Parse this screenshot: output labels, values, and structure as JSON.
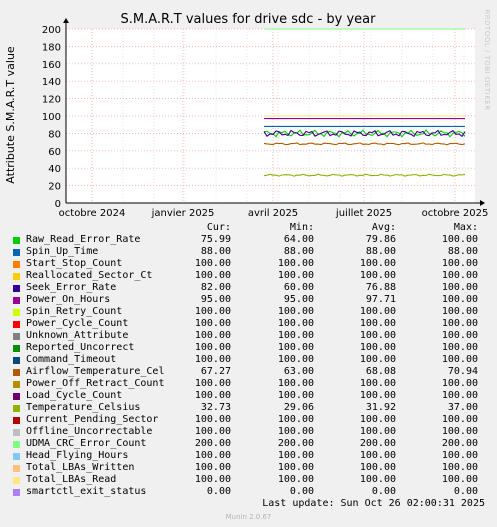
{
  "chart_data": {
    "type": "line",
    "title": "S.M.A.R.T values for drive sdc - by year",
    "ylabel": "Attribute S.M.A.R.T value",
    "side_text": "RRDTOOL / TOBI OETIKER",
    "ylim": [
      0,
      200
    ],
    "y_ticks": [
      "0",
      "20",
      "40",
      "60",
      "80",
      "100",
      "120",
      "140",
      "160",
      "180",
      "200"
    ],
    "x_ticks": [
      "octobre 2024",
      "janvier 2025",
      "avril 2025",
      "juillet 2025",
      "octobre 2025"
    ],
    "grid": true,
    "columns": [
      "Cur:",
      "Min:",
      "Avg:",
      "Max:"
    ],
    "series": [
      {
        "name": "Raw_Read_Error_Rate",
        "color": "#00cc00",
        "cur": "75.99",
        "min": "64.00",
        "avg": "79.86",
        "max": "100.00",
        "level": 80
      },
      {
        "name": "Spin_Up_Time",
        "color": "#0066b3",
        "cur": "88.00",
        "min": "88.00",
        "avg": "88.00",
        "max": "88.00",
        "level": 88
      },
      {
        "name": "Start_Stop_Count",
        "color": "#ff8000",
        "cur": "100.00",
        "min": "100.00",
        "avg": "100.00",
        "max": "100.00",
        "level": 100
      },
      {
        "name": "Reallocated_Sector_Ct",
        "color": "#ffcc00",
        "cur": "100.00",
        "min": "100.00",
        "avg": "100.00",
        "max": "100.00",
        "level": 100
      },
      {
        "name": "Seek_Error_Rate",
        "color": "#330099",
        "cur": "82.00",
        "min": "60.00",
        "avg": "76.88",
        "max": "100.00",
        "level": 80
      },
      {
        "name": "Power_On_Hours",
        "color": "#990099",
        "cur": "95.00",
        "min": "95.00",
        "avg": "97.71",
        "max": "100.00",
        "level": 97
      },
      {
        "name": "Spin_Retry_Count",
        "color": "#ccff00",
        "cur": "100.00",
        "min": "100.00",
        "avg": "100.00",
        "max": "100.00",
        "level": 100
      },
      {
        "name": "Power_Cycle_Count",
        "color": "#ff0000",
        "cur": "100.00",
        "min": "100.00",
        "avg": "100.00",
        "max": "100.00",
        "level": 100
      },
      {
        "name": "Unknown_Attribute",
        "color": "#808080",
        "cur": "100.00",
        "min": "100.00",
        "avg": "100.00",
        "max": "100.00",
        "level": 100
      },
      {
        "name": "Reported_Uncorrect",
        "color": "#008f00",
        "cur": "100.00",
        "min": "100.00",
        "avg": "100.00",
        "max": "100.00",
        "level": 100
      },
      {
        "name": "Command_Timeout",
        "color": "#00487d",
        "cur": "100.00",
        "min": "100.00",
        "avg": "100.00",
        "max": "100.00",
        "level": 100
      },
      {
        "name": "Airflow_Temperature_Cel",
        "color": "#b35a00",
        "cur": "67.27",
        "min": "63.00",
        "avg": "68.08",
        "max": "70.94",
        "level": 68
      },
      {
        "name": "Power_Off_Retract_Count",
        "color": "#b38f00",
        "cur": "100.00",
        "min": "100.00",
        "avg": "100.00",
        "max": "100.00",
        "level": 100
      },
      {
        "name": "Load_Cycle_Count",
        "color": "#6b006b",
        "cur": "100.00",
        "min": "100.00",
        "avg": "100.00",
        "max": "100.00",
        "level": 100
      },
      {
        "name": "Temperature_Celsius",
        "color": "#8fb300",
        "cur": "32.73",
        "min": "29.06",
        "avg": "31.92",
        "max": "37.00",
        "level": 32
      },
      {
        "name": "Current_Pending_Sector",
        "color": "#b30000",
        "cur": "100.00",
        "min": "100.00",
        "avg": "100.00",
        "max": "100.00",
        "level": 100
      },
      {
        "name": "Offline_Uncorrectable",
        "color": "#bebebe",
        "cur": "100.00",
        "min": "100.00",
        "avg": "100.00",
        "max": "100.00",
        "level": 100
      },
      {
        "name": "UDMA_CRC_Error_Count",
        "color": "#80ff80",
        "cur": "200.00",
        "min": "200.00",
        "avg": "200.00",
        "max": "200.00",
        "level": 200
      },
      {
        "name": "Head_Flying_Hours",
        "color": "#80c9ff",
        "cur": "100.00",
        "min": "100.00",
        "avg": "100.00",
        "max": "100.00",
        "level": 100
      },
      {
        "name": "Total_LBAs_Written",
        "color": "#ffc080",
        "cur": "100.00",
        "min": "100.00",
        "avg": "100.00",
        "max": "100.00",
        "level": 100
      },
      {
        "name": "Total_LBAs_Read",
        "color": "#ffe680",
        "cur": "100.00",
        "min": "100.00",
        "avg": "100.00",
        "max": "100.00",
        "level": 100
      },
      {
        "name": "smartctl_exit_status",
        "color": "#aa80ff",
        "cur": "0.00",
        "min": "0.00",
        "avg": "0.00",
        "max": "0.00",
        "level": 0
      }
    ],
    "last_update": "Last update: Sun Oct 26 02:00:31 2025",
    "munin_version": "Munin 2.0.67"
  }
}
